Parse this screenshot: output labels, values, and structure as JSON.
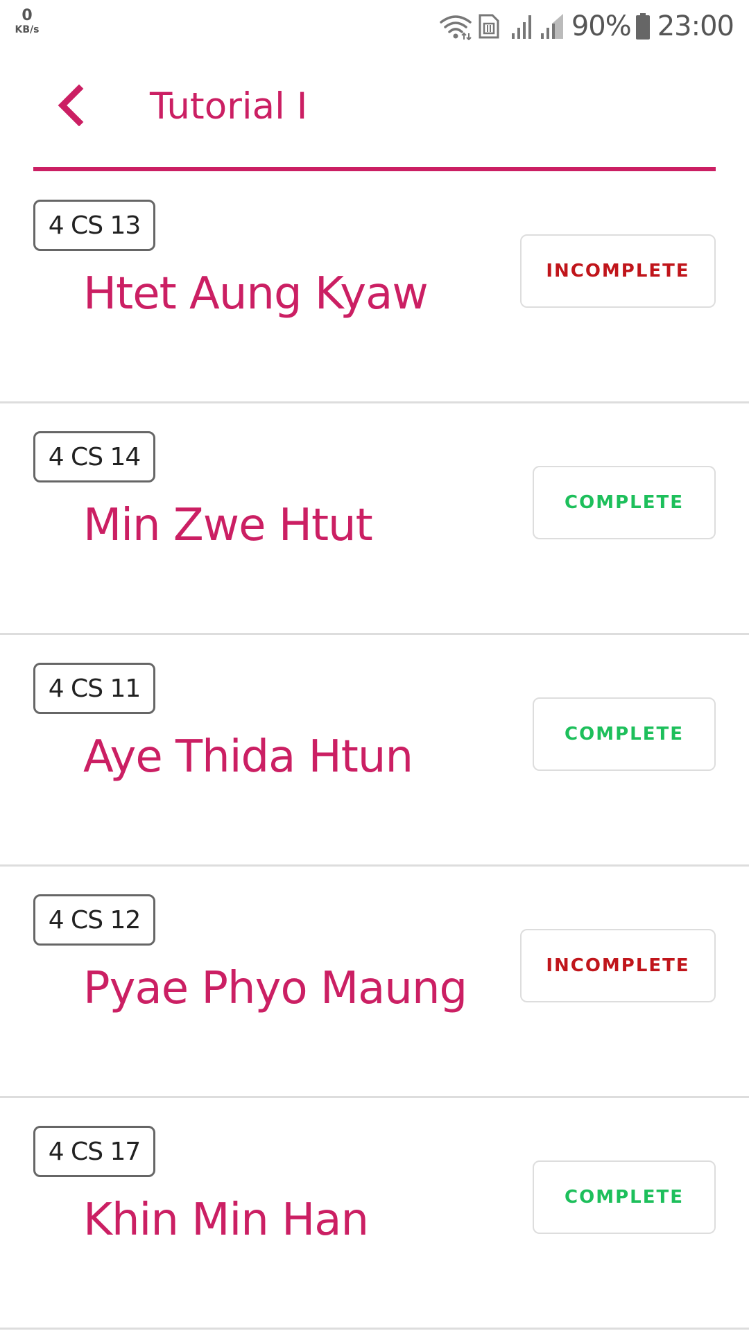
{
  "status_bar": {
    "net_speed_value": "0",
    "net_speed_unit": "KB/s",
    "battery_percent": "90%",
    "time": "23:00",
    "icons": [
      "wifi-icon",
      "sim-icon",
      "signal-icon",
      "signal-icon-2",
      "battery-icon"
    ]
  },
  "header": {
    "back_icon": "chevron-left-icon",
    "title": "Tutorial I"
  },
  "colors": {
    "accent": "#cb1f63",
    "incomplete": "#c0151b",
    "complete": "#1dbf5b",
    "divider": "#dddddd"
  },
  "students": [
    {
      "roll": "4 CS 13",
      "name": "Htet Aung Kyaw",
      "status": "INCOMPLETE"
    },
    {
      "roll": "4 CS 14",
      "name": "Min Zwe Htut",
      "status": "COMPLETE"
    },
    {
      "roll": "4 CS 11",
      "name": "Aye Thida Htun",
      "status": "COMPLETE"
    },
    {
      "roll": "4 CS 12",
      "name": "Pyae Phyo Maung",
      "status": "INCOMPLETE"
    },
    {
      "roll": "4 CS 17",
      "name": "Khin Min Han",
      "status": "COMPLETE"
    }
  ]
}
